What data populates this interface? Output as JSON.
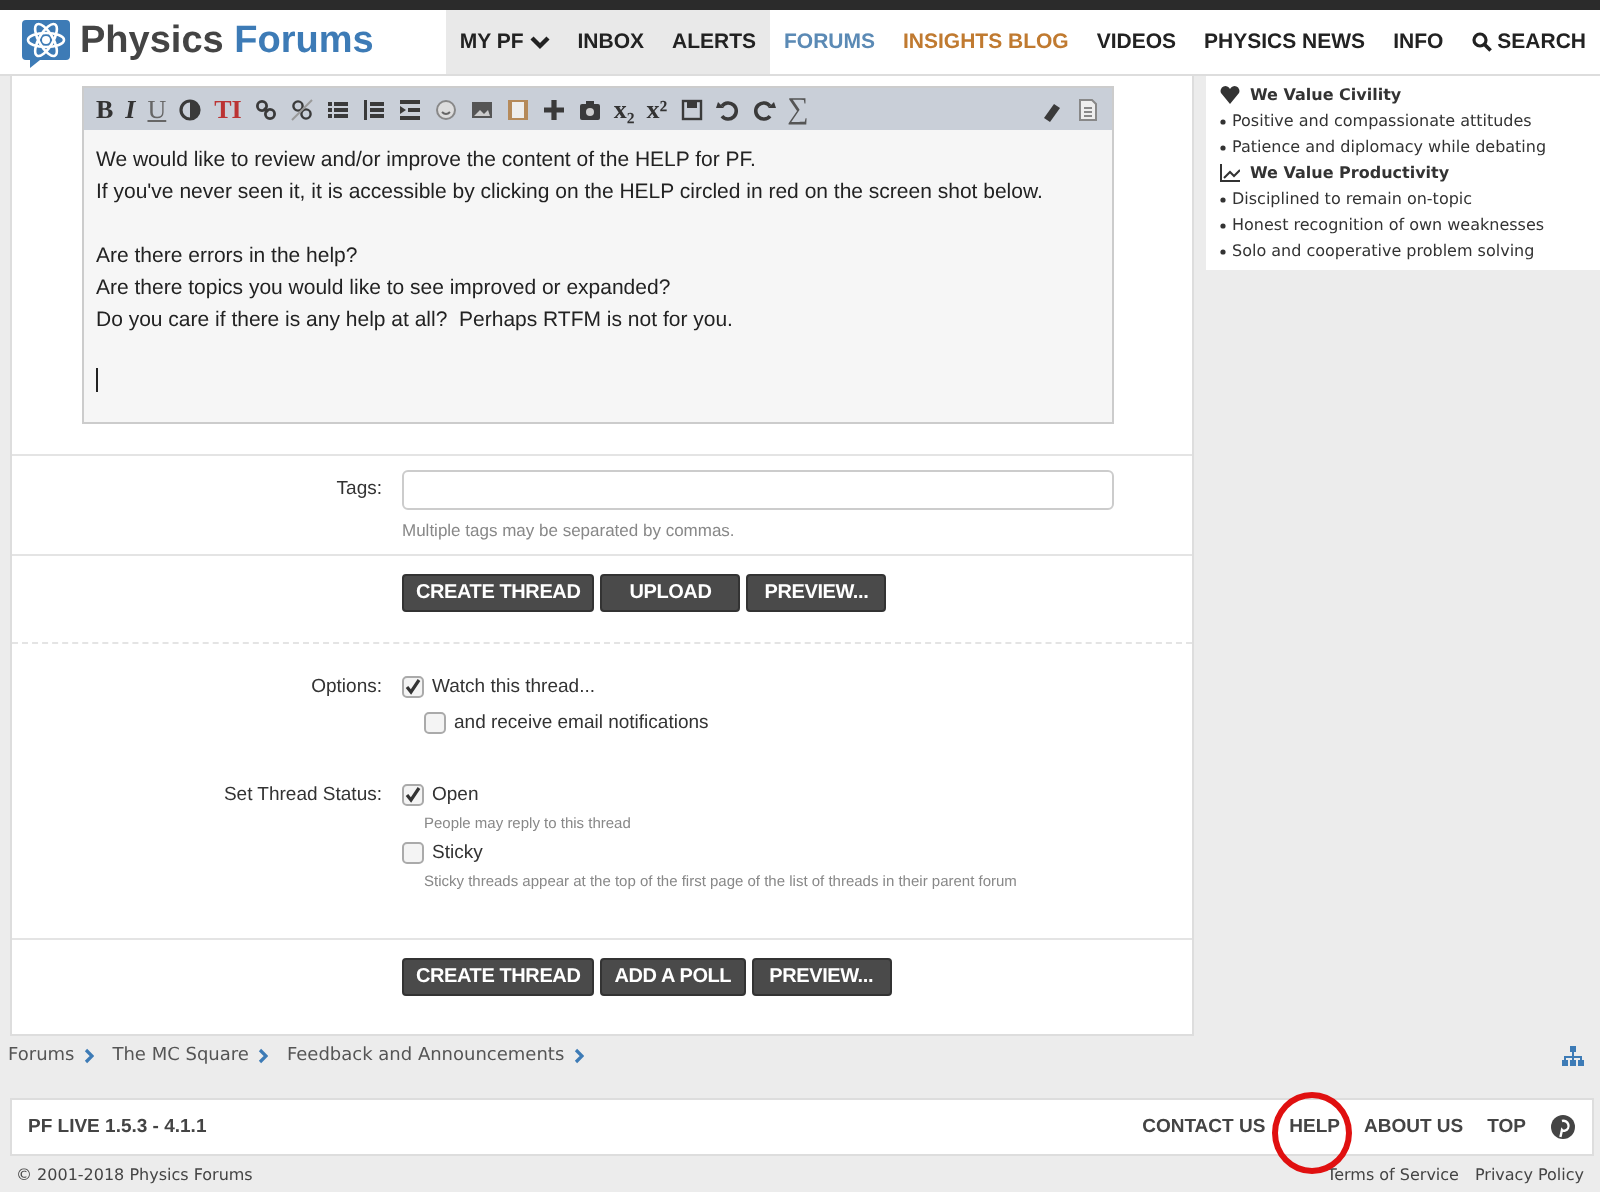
{
  "header": {
    "logo": "Physics Forums",
    "nav": [
      {
        "label": "MY PF",
        "kind": "account",
        "selected": false,
        "dropdown": true
      },
      {
        "label": "INBOX",
        "kind": "account",
        "selected": false,
        "dropdown": false
      },
      {
        "label": "ALERTS",
        "kind": "account",
        "selected": false,
        "dropdown": false
      },
      {
        "label": "FORUMS",
        "kind": "section",
        "selected": true,
        "dropdown": false
      },
      {
        "label": "INSIGHTS BLOG",
        "kind": "featured",
        "selected": false,
        "dropdown": false
      },
      {
        "label": "VIDEOS",
        "kind": "section",
        "selected": false,
        "dropdown": false
      },
      {
        "label": "PHYSICS NEWS",
        "kind": "section",
        "selected": false,
        "dropdown": false
      },
      {
        "label": "INFO",
        "kind": "section",
        "selected": false,
        "dropdown": false
      },
      {
        "label": "SEARCH",
        "kind": "search",
        "selected": false,
        "dropdown": false
      }
    ]
  },
  "editor": {
    "toolbar": [
      {
        "kind": "bold",
        "label": "B"
      },
      {
        "kind": "italic",
        "label": "I"
      },
      {
        "kind": "underline",
        "label": "U"
      },
      {
        "kind": "color"
      },
      {
        "kind": "font-size",
        "label": "TI"
      },
      {
        "kind": "link"
      },
      {
        "kind": "unlink"
      },
      {
        "kind": "bullets"
      },
      {
        "kind": "numbers"
      },
      {
        "kind": "indent"
      },
      {
        "kind": "smiley"
      },
      {
        "kind": "image"
      },
      {
        "kind": "media"
      },
      {
        "kind": "plus"
      },
      {
        "kind": "camera"
      },
      {
        "kind": "subscript",
        "label": "x₂"
      },
      {
        "kind": "superscript",
        "label": "x²"
      },
      {
        "kind": "save"
      },
      {
        "kind": "undo"
      },
      {
        "kind": "redo"
      },
      {
        "kind": "sigma",
        "label": "∑"
      },
      {
        "kind": "eraser"
      },
      {
        "kind": "source"
      }
    ],
    "paragraphs": [
      [
        "We would like to review and/or improve the content of the HELP for PF.",
        "If you've never seen it, it is accessible by clicking on the HELP circled in red on the screen shot below."
      ],
      [
        "Are there errors in the help?",
        "Are there topics you would like to see improved or expanded?",
        "Do you care if there is any help at all?  Perhaps RTFM is not for you."
      ]
    ]
  },
  "tags": {
    "label": "Tags:",
    "hint": "Multiple tags may be separated by commas."
  },
  "buttons_top": [
    "CREATE THREAD",
    "UPLOAD",
    "PREVIEW..."
  ],
  "options": {
    "label": "Options:",
    "items": [
      {
        "label": "Watch this thread...",
        "checked": true,
        "nested": false
      },
      {
        "label": "and receive email notifications",
        "checked": false,
        "nested": true
      }
    ]
  },
  "thread_status": {
    "label": "Set Thread Status:",
    "items": [
      {
        "label": "Open",
        "checked": true,
        "hint": "People may reply to this thread"
      },
      {
        "label": "Sticky",
        "checked": false,
        "hint": "Sticky threads appear at the top of the first page of the list of threads in their parent forum"
      }
    ]
  },
  "buttons_bottom": [
    "CREATE THREAD",
    "ADD A POLL",
    "PREVIEW..."
  ],
  "sidebar": [
    {
      "kind": "heading",
      "label": "We Value Civility"
    },
    {
      "kind": "bullet",
      "label": "Positive and compassionate attitudes"
    },
    {
      "kind": "bullet",
      "label": "Patience and diplomacy while debating"
    },
    {
      "kind": "heading",
      "label": "We Value Productivity"
    },
    {
      "kind": "bullet",
      "label": "Disciplined to remain on-topic"
    },
    {
      "kind": "bullet",
      "label": "Honest recognition of own weaknesses"
    },
    {
      "kind": "bullet",
      "label": "Solo and cooperative problem solving"
    }
  ],
  "breadcrumb": [
    "Forums",
    "The MC Square",
    "Feedback and Announcements"
  ],
  "footer": {
    "version": "PF LIVE 1.5.3 - 4.1.1",
    "links": [
      {
        "label": "CONTACT US",
        "circled": false
      },
      {
        "label": "HELP",
        "circled": true
      },
      {
        "label": "ABOUT US",
        "circled": false
      },
      {
        "label": "TOP",
        "circled": false
      }
    ],
    "copyright": "© 2001-2018 Physics Forums",
    "legal": [
      "Terms of Service",
      "Privacy Policy"
    ]
  }
}
